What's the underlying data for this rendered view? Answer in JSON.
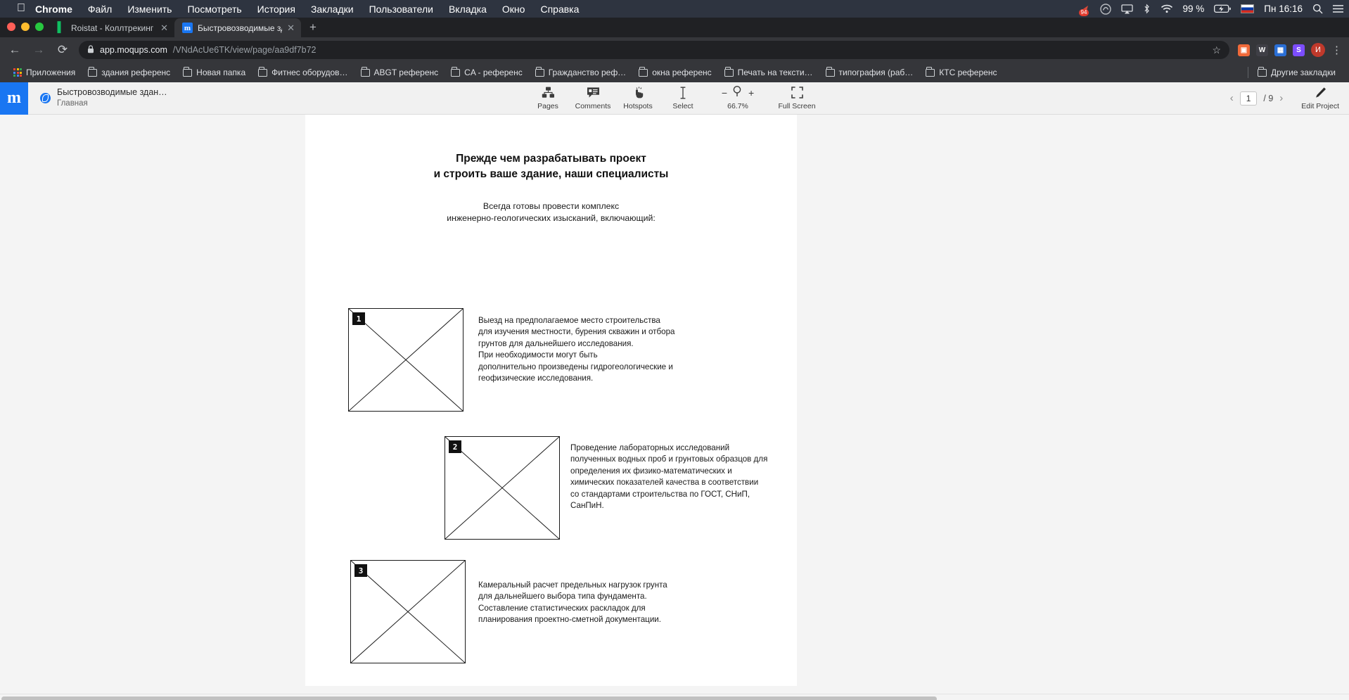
{
  "macbar": {
    "apple_icon": "apple-logo",
    "menus": [
      {
        "label": "Chrome",
        "bold": true
      },
      {
        "label": "Файл",
        "bold": false
      },
      {
        "label": "Изменить",
        "bold": false
      },
      {
        "label": "Посмотреть",
        "bold": false
      },
      {
        "label": "История",
        "bold": false
      },
      {
        "label": "Закладки",
        "bold": false
      },
      {
        "label": "Пользователи",
        "bold": false
      },
      {
        "label": "Вкладка",
        "bold": false
      },
      {
        "label": "Окно",
        "bold": false
      },
      {
        "label": "Справка",
        "bold": false
      }
    ],
    "status": {
      "notification_badge": "94",
      "battery": "99 %",
      "language": "RU",
      "datetime": "Пн 16:16",
      "icons": [
        "arrow-up-red-icon",
        "creative-cloud-icon",
        "airplay-icon",
        "bluetooth-icon",
        "wifi-icon",
        "battery-charging-icon",
        "flag-ru-icon",
        "search-icon",
        "control-center-icon"
      ]
    }
  },
  "browser": {
    "tabs": [
      {
        "title": "Roistat - Коллтрекинг - Истор",
        "favicon": "roistat-icon",
        "active": false
      },
      {
        "title": "Быстровозводимые здания (П",
        "favicon": "moqups-icon",
        "active": true
      }
    ],
    "new_tab_label": "+",
    "nav": {
      "back": "←",
      "forward": "→",
      "reload": "⟳"
    },
    "omnibox": {
      "lock_icon": "lock-icon",
      "url_domain": "app.moqups.com",
      "url_path": "/VNdAcUe6TK/view/page/aa9df7b72",
      "star_icon": "star-icon"
    },
    "extensions": [
      {
        "name": "extension-1",
        "glyph": "▣"
      },
      {
        "name": "extension-wikipedia",
        "glyph": "W"
      },
      {
        "name": "extension-3",
        "glyph": "▦"
      },
      {
        "name": "extension-4",
        "glyph": "S"
      }
    ],
    "profile_initial": "И",
    "menu_icon": "kebab-menu-icon",
    "bookmarks": [
      {
        "label": "Приложения",
        "icon": "apps-grid-icon"
      },
      {
        "label": "здания референс",
        "icon": "folder-icon"
      },
      {
        "label": "Новая папка",
        "icon": "folder-icon"
      },
      {
        "label": "Фитнес оборудов…",
        "icon": "folder-icon"
      },
      {
        "label": "ABGT референс",
        "icon": "folder-icon"
      },
      {
        "label": "CA - референс",
        "icon": "folder-icon"
      },
      {
        "label": "Гражданство реф…",
        "icon": "folder-icon"
      },
      {
        "label": "окна референс",
        "icon": "folder-icon"
      },
      {
        "label": "Печать на тексти…",
        "icon": "folder-icon"
      },
      {
        "label": "типография (раб…",
        "icon": "folder-icon"
      },
      {
        "label": "КТС референс",
        "icon": "folder-icon"
      }
    ],
    "other_bookmarks": {
      "label": "Другие закладки",
      "icon": "folder-icon"
    }
  },
  "app": {
    "logo": "m",
    "project_title": "Быстровозводимые здан…",
    "project_page": "Главная",
    "tools": [
      {
        "label": "Pages",
        "icon": "sitemap-icon"
      },
      {
        "label": "Comments",
        "icon": "comment-icon"
      },
      {
        "label": "Hotspots",
        "icon": "cursor-click-icon"
      },
      {
        "label": "Select",
        "icon": "text-cursor-icon"
      }
    ],
    "zoom": {
      "minus": "−",
      "plus": "+",
      "level": "66.7%",
      "icon": "magnifier-icon"
    },
    "fullscreen": {
      "label": "Full Screen",
      "icon": "expand-icon"
    },
    "pagination": {
      "prev_icon": "chevron-left-icon",
      "next_icon": "chevron-right-icon",
      "current": "1",
      "separator": "/ 9"
    },
    "edit_project": {
      "label": "Edit Project",
      "icon": "pencil-icon"
    }
  },
  "document": {
    "heading_line1": "Прежде чем разрабатывать проект",
    "heading_line2": "и строить ваше здание, наши специалисты",
    "lead_line1": "Всегда готовы провести комплекс",
    "lead_line2": "инженерно-геологических изысканий, включающий:",
    "blocks": [
      {
        "number": "1",
        "image_placeholder": "image-placeholder-crossed-box",
        "text": "Выезд на предполагаемое место строительства для изучения местности, бурения скважин и отбора грунтов для дальнейшего исследования.\nПри необходимости могут быть дополнительно произведены гидрогеологические и геофизические исследования."
      },
      {
        "number": "2",
        "image_placeholder": "image-placeholder-crossed-box",
        "text": "Проведение лабораторных исследований полученных водных проб и грунтовых образцов для определения их физико-математических и химических показателей качества в соответствии со стандартами строительства по ГОСТ, СНиП, СанПиН."
      },
      {
        "number": "3",
        "image_placeholder": "image-placeholder-crossed-box",
        "text": "Камеральный расчет предельных нагрузок грунта для дальнейшего выбора типа фундамента.\nСоставление статистических раскладок для планирования проектно-сметной документации."
      }
    ]
  },
  "colors": {
    "brand_blue": "#1976f2",
    "chrome_dark": "#202124",
    "chrome_toolbar": "#35363a",
    "app_bar": "#f1f1f1",
    "canvas": "#f4f4f4"
  }
}
